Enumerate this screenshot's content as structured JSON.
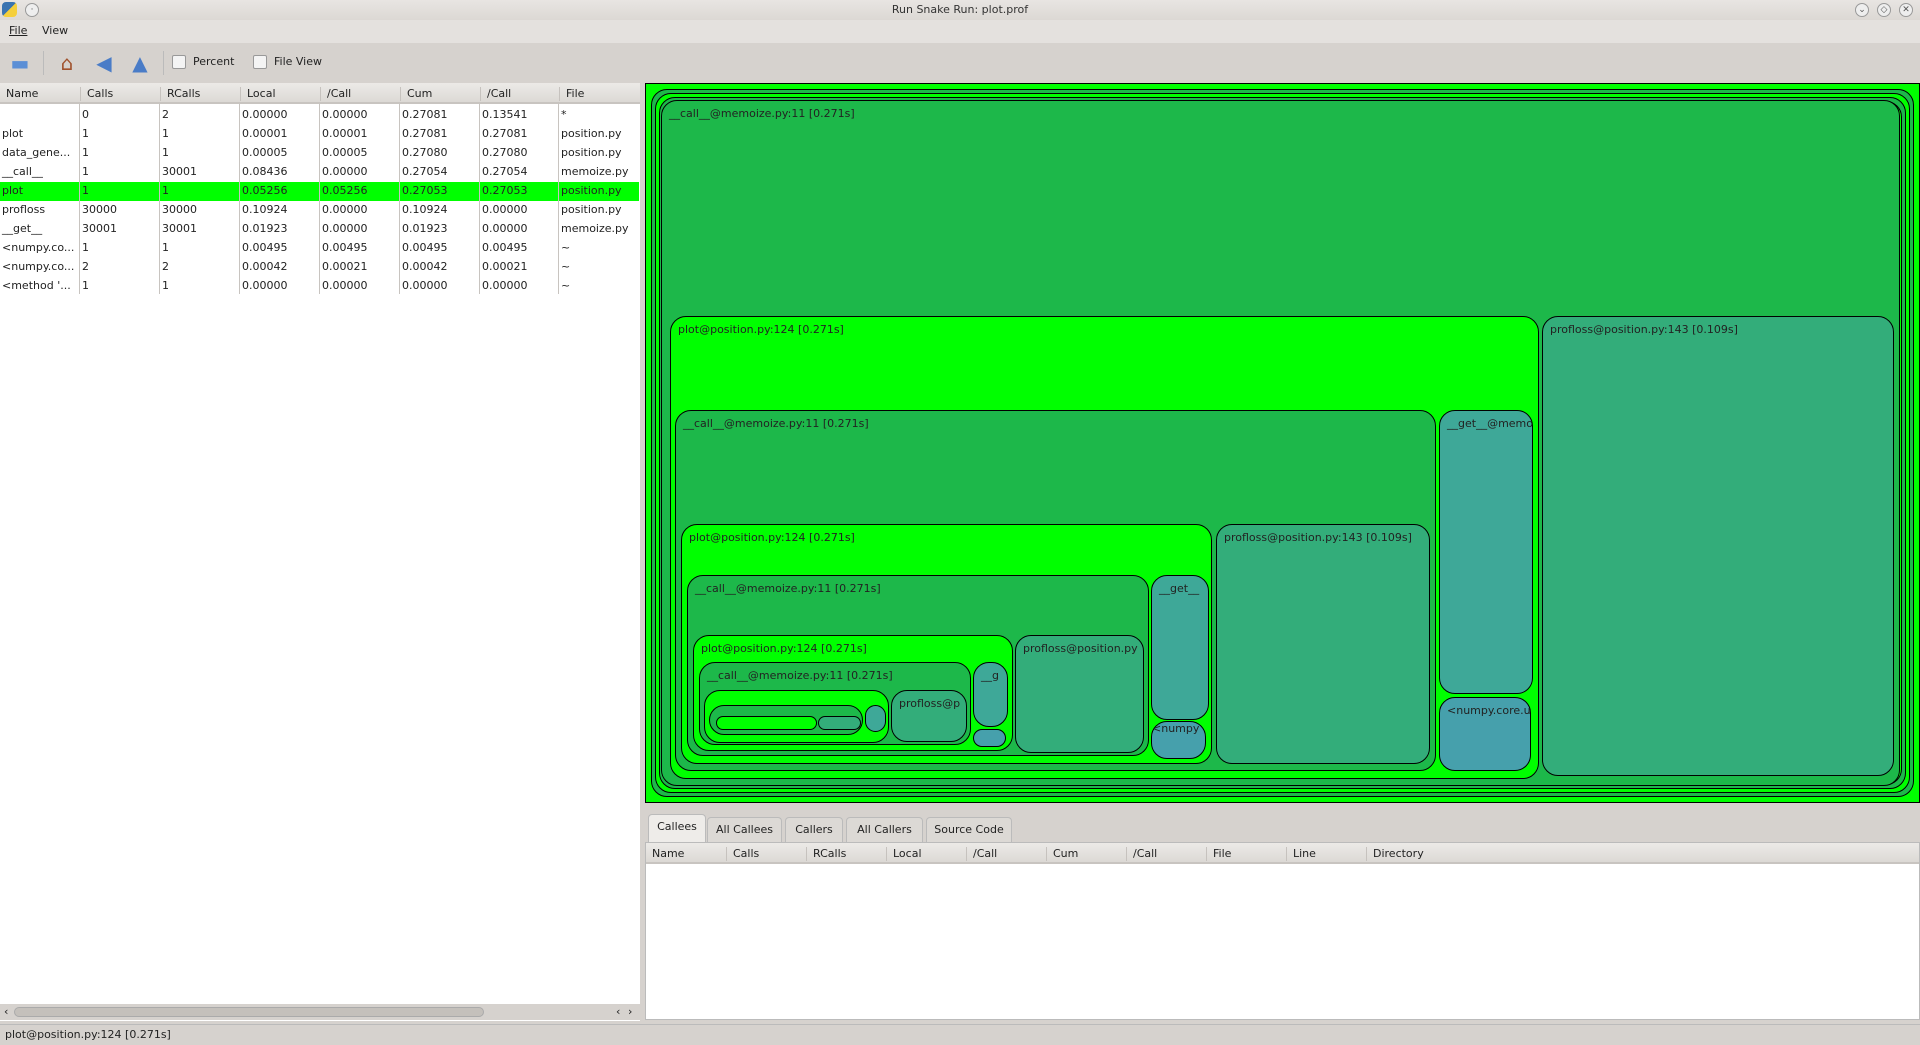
{
  "window": {
    "title": "Run Snake Run: plot.prof"
  },
  "menu": {
    "file": "File",
    "view": "View"
  },
  "toolbar": {
    "percent_label": "Percent",
    "fileview_label": "File View"
  },
  "colors": {
    "selected": "#00ff00",
    "treemap_bright": "#00ff00",
    "treemap_green": "#1db84a",
    "treemap_teal": "#33ad7a"
  },
  "table": {
    "columns": [
      "Name",
      "Calls",
      "RCalls",
      "Local",
      "/Call",
      "Cum",
      "/Call",
      "File"
    ],
    "rows": [
      [
        "",
        "0",
        "2",
        "0.00000",
        "0.00000",
        "0.27081",
        "0.13541",
        "*"
      ],
      [
        "plot",
        "1",
        "1",
        "0.00001",
        "0.00001",
        "0.27081",
        "0.27081",
        "position.py"
      ],
      [
        "data_gene...",
        "1",
        "1",
        "0.00005",
        "0.00005",
        "0.27080",
        "0.27080",
        "position.py"
      ],
      [
        "__call__",
        "1",
        "30001",
        "0.08436",
        "0.00000",
        "0.27054",
        "0.27054",
        "memoize.py"
      ],
      [
        "plot",
        "1",
        "1",
        "0.05256",
        "0.05256",
        "0.27053",
        "0.27053",
        "position.py"
      ],
      [
        "profloss",
        "30000",
        "30000",
        "0.10924",
        "0.00000",
        "0.10924",
        "0.00000",
        "position.py"
      ],
      [
        "__get__",
        "30001",
        "30001",
        "0.01923",
        "0.00000",
        "0.01923",
        "0.00000",
        "memoize.py"
      ],
      [
        "<numpy.co...",
        "1",
        "1",
        "0.00495",
        "0.00495",
        "0.00495",
        "0.00495",
        "~"
      ],
      [
        "<numpy.co...",
        "2",
        "2",
        "0.00042",
        "0.00021",
        "0.00042",
        "0.00021",
        "~"
      ],
      [
        "<method '...",
        "1",
        "1",
        "0.00000",
        "0.00000",
        "0.00000",
        "0.00000",
        "~"
      ]
    ],
    "selected_row": 4
  },
  "treemap": {
    "nodes": [
      {
        "label": "__call__@memoize.py:11 [0.271s]"
      },
      {
        "label": "plot@position.py:124 [0.271s]"
      },
      {
        "label": "profloss@position.py:143 [0.109s]"
      },
      {
        "label": "__call__@memoize.py:11 [0.271s]"
      },
      {
        "label": "__get__@memoize"
      },
      {
        "label": "<numpy.core.umath"
      },
      {
        "label": "plot@position.py:124 [0.271s]"
      },
      {
        "label": "profloss@position.py:143 [0.109s]"
      },
      {
        "label": "__call__@memoize.py:11 [0.271s]"
      },
      {
        "label": "__get__"
      },
      {
        "label": "<numpy"
      },
      {
        "label": "plot@position.py:124 [0.271s]"
      },
      {
        "label": "profloss@position.py"
      },
      {
        "label": "__call__@memoize.py:11 [0.271s]"
      },
      {
        "label": "__g"
      },
      {
        "label": ""
      },
      {
        "label": ""
      },
      {
        "label": "profloss@p"
      },
      {
        "label": ""
      },
      {
        "label": ""
      },
      {
        "label": ""
      },
      {
        "label": ""
      }
    ]
  },
  "tabs": [
    "Callees",
    "All Callees",
    "Callers",
    "All Callers",
    "Source Code"
  ],
  "detail_columns": [
    "Name",
    "Calls",
    "RCalls",
    "Local",
    "/Call",
    "Cum",
    "/Call",
    "File",
    "Line",
    "Directory"
  ],
  "status": "plot@position.py:124 [0.271s]"
}
